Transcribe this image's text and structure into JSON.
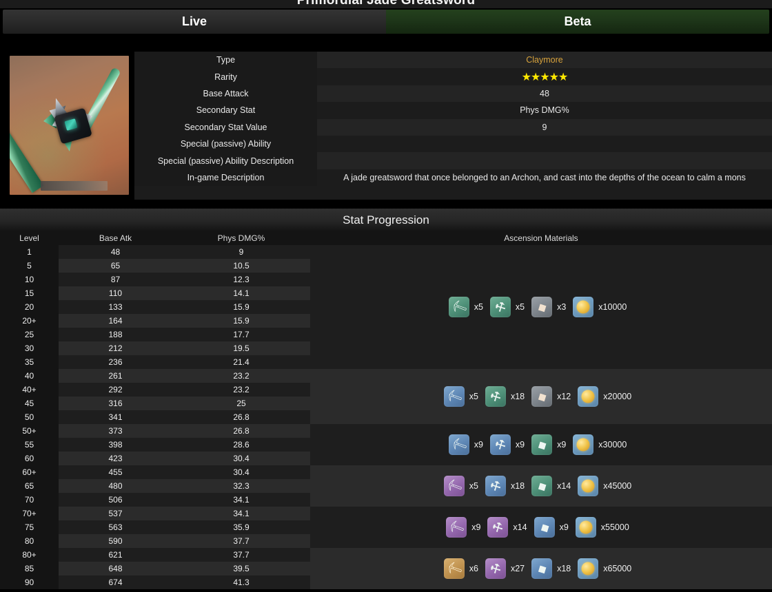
{
  "page_title": "Primordial Jade Greatsword",
  "tabs": [
    {
      "label": "Live",
      "active": false
    },
    {
      "label": "Beta",
      "active": true
    }
  ],
  "thumbnail": {
    "alt": "Primordial Jade Greatsword weapon artwork"
  },
  "info": {
    "rows": [
      {
        "label": "Type",
        "value": "Claymore",
        "style": "accent"
      },
      {
        "label": "Rarity",
        "value": "★★★★★",
        "style": "stars"
      },
      {
        "label": "Base Attack",
        "value": "48",
        "style": "plain"
      },
      {
        "label": "Secondary Stat",
        "value": "Phys DMG%",
        "style": "plain"
      },
      {
        "label": "Secondary Stat Value",
        "value": "9",
        "style": "plain"
      },
      {
        "label": "Special (passive) Ability",
        "value": "",
        "style": "plain"
      },
      {
        "label": "Special (passive) Ability Description",
        "value": "",
        "style": "plain"
      },
      {
        "label": "In-game Description",
        "value": "A jade greatsword that once belonged to an Archon, and cast into the depths of the ocean to calm a mons",
        "style": "desc"
      }
    ]
  },
  "stat_progression": {
    "title": "Stat Progression",
    "columns": [
      "Level",
      "Base Atk",
      "Phys DMG%",
      "Ascension Materials"
    ],
    "rows": [
      {
        "level": "1",
        "base_atk": "48",
        "phys_dmg": "9"
      },
      {
        "level": "5",
        "base_atk": "65",
        "phys_dmg": "10.5"
      },
      {
        "level": "10",
        "base_atk": "87",
        "phys_dmg": "12.3"
      },
      {
        "level": "15",
        "base_atk": "110",
        "phys_dmg": "14.1"
      },
      {
        "level": "20",
        "base_atk": "133",
        "phys_dmg": "15.9"
      },
      {
        "level": "20+",
        "base_atk": "164",
        "phys_dmg": "15.9"
      },
      {
        "level": "25",
        "base_atk": "188",
        "phys_dmg": "17.7"
      },
      {
        "level": "30",
        "base_atk": "212",
        "phys_dmg": "19.5"
      },
      {
        "level": "35",
        "base_atk": "236",
        "phys_dmg": "21.4"
      },
      {
        "level": "40",
        "base_atk": "261",
        "phys_dmg": "23.2"
      },
      {
        "level": "40+",
        "base_atk": "292",
        "phys_dmg": "23.2"
      },
      {
        "level": "45",
        "base_atk": "316",
        "phys_dmg": "25"
      },
      {
        "level": "50",
        "base_atk": "341",
        "phys_dmg": "26.8"
      },
      {
        "level": "50+",
        "base_atk": "373",
        "phys_dmg": "26.8"
      },
      {
        "level": "55",
        "base_atk": "398",
        "phys_dmg": "28.6"
      },
      {
        "level": "60",
        "base_atk": "423",
        "phys_dmg": "30.4"
      },
      {
        "level": "60+",
        "base_atk": "455",
        "phys_dmg": "30.4"
      },
      {
        "level": "65",
        "base_atk": "480",
        "phys_dmg": "32.3"
      },
      {
        "level": "70",
        "base_atk": "506",
        "phys_dmg": "34.1"
      },
      {
        "level": "70+",
        "base_atk": "537",
        "phys_dmg": "34.1"
      },
      {
        "level": "75",
        "base_atk": "563",
        "phys_dmg": "35.9"
      },
      {
        "level": "80",
        "base_atk": "590",
        "phys_dmg": "37.7"
      },
      {
        "level": "80+",
        "base_atk": "621",
        "phys_dmg": "37.7"
      },
      {
        "level": "85",
        "base_atk": "648",
        "phys_dmg": "39.5"
      },
      {
        "level": "90",
        "base_atk": "674",
        "phys_dmg": "41.3"
      }
    ],
    "ascensions": [
      {
        "row_index": 7,
        "stripe": "odd",
        "items": [
          {
            "icon": "weapon-ascension-material-icon",
            "rarity": "green",
            "count": "x5"
          },
          {
            "icon": "elite-enemy-drop-icon",
            "rarity": "green",
            "count": "x5"
          },
          {
            "icon": "common-enemy-drop-icon",
            "rarity": "gray",
            "count": "x3"
          },
          {
            "icon": "mora-icon",
            "rarity": "mora",
            "count": "x10000"
          }
        ]
      },
      {
        "row_index": 11,
        "stripe": "even",
        "items": [
          {
            "icon": "weapon-ascension-material-icon",
            "rarity": "blue",
            "count": "x5"
          },
          {
            "icon": "elite-enemy-drop-icon",
            "rarity": "green",
            "count": "x18"
          },
          {
            "icon": "common-enemy-drop-icon",
            "rarity": "gray",
            "count": "x12"
          },
          {
            "icon": "mora-icon",
            "rarity": "mora",
            "count": "x20000"
          }
        ]
      },
      {
        "row_index": 14,
        "stripe": "odd",
        "items": [
          {
            "icon": "weapon-ascension-material-icon",
            "rarity": "blue",
            "count": "x9"
          },
          {
            "icon": "elite-enemy-drop-icon",
            "rarity": "blue",
            "count": "x9"
          },
          {
            "icon": "common-enemy-drop-icon",
            "rarity": "green",
            "count": "x9"
          },
          {
            "icon": "mora-icon",
            "rarity": "mora",
            "count": "x30000"
          }
        ]
      },
      {
        "row_index": 17,
        "stripe": "even",
        "items": [
          {
            "icon": "weapon-ascension-material-icon",
            "rarity": "purple",
            "count": "x5"
          },
          {
            "icon": "elite-enemy-drop-icon",
            "rarity": "blue",
            "count": "x18"
          },
          {
            "icon": "common-enemy-drop-icon",
            "rarity": "green",
            "count": "x14"
          },
          {
            "icon": "mora-icon",
            "rarity": "mora",
            "count": "x45000"
          }
        ]
      },
      {
        "row_index": 20,
        "stripe": "odd",
        "items": [
          {
            "icon": "weapon-ascension-material-icon",
            "rarity": "purple",
            "count": "x9"
          },
          {
            "icon": "elite-enemy-drop-icon",
            "rarity": "purple",
            "count": "x14"
          },
          {
            "icon": "common-enemy-drop-icon",
            "rarity": "blue",
            "count": "x9"
          },
          {
            "icon": "mora-icon",
            "rarity": "mora",
            "count": "x55000"
          }
        ]
      },
      {
        "row_index": 23,
        "stripe": "even",
        "items": [
          {
            "icon": "weapon-ascension-material-icon",
            "rarity": "gold",
            "count": "x6"
          },
          {
            "icon": "elite-enemy-drop-icon",
            "rarity": "purple",
            "count": "x27"
          },
          {
            "icon": "common-enemy-drop-icon",
            "rarity": "blue",
            "count": "x18"
          },
          {
            "icon": "mora-icon",
            "rarity": "mora",
            "count": "x65000"
          }
        ]
      }
    ]
  },
  "colors": {
    "accent": "#d8a33c",
    "star": "#ffe800",
    "beta_tab": "#1e3619",
    "live_tab": "#2b2b2b",
    "background": "#141414"
  }
}
